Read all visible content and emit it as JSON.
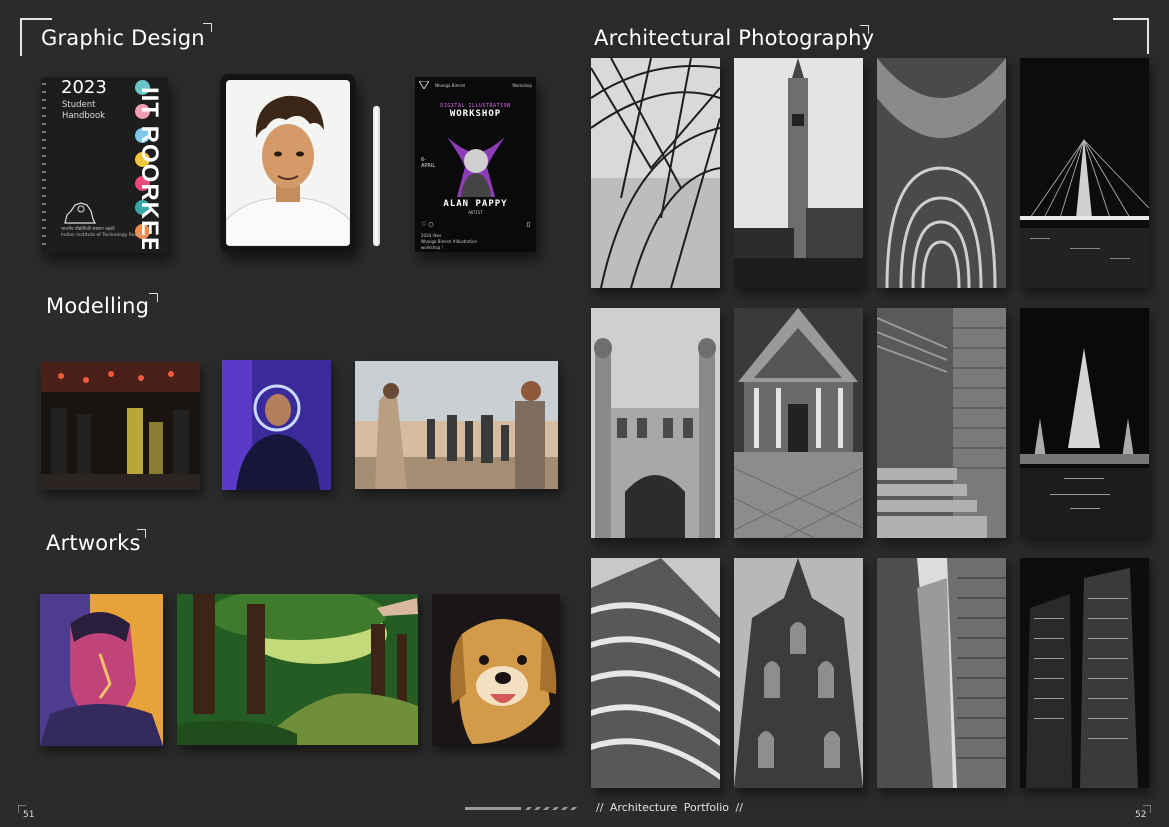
{
  "sections": {
    "graphic_design": "Graphic Design",
    "modelling": "Modelling",
    "artworks": "Artworks",
    "architectural_photography": "Architectural Photography"
  },
  "handbook": {
    "year": "2023",
    "subtitle": "Student Handbook",
    "vertical_title": "IIT ROORKEE",
    "footer_hindi": "भारतीय प्रौद्योगिकी संस्थान रुड़की",
    "footer_en": "Indian Institute of Technology Roorkee"
  },
  "poster": {
    "account": "Nhanga Bimrot",
    "tag": "Workshop",
    "title_small": "DIGITAL ILLUSTRATION",
    "title_big": "WORKSHOP",
    "date": "6- APRIL",
    "name": "ALAN PAPPY",
    "role": "ARTIST",
    "likes": "2024 likes",
    "caption": "Nhanga Bimrot #illustration",
    "caption2": "workshop !"
  },
  "footer": {
    "left_page": "51",
    "right_page": "52",
    "center_text": "// Architecture Portfolio //"
  },
  "colors": {
    "background": "#2b2b2b",
    "text": "#ffffff"
  }
}
